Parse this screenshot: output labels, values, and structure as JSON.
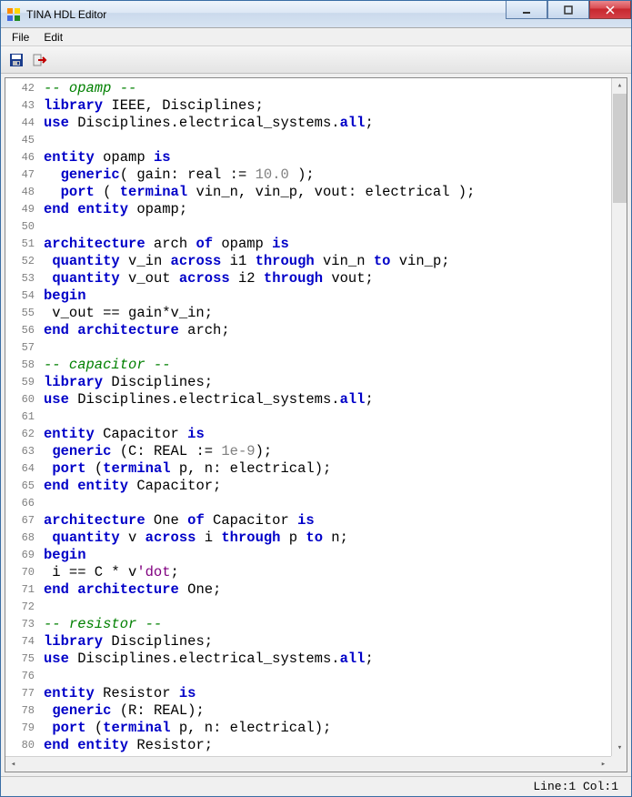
{
  "window": {
    "title": "TINA HDL Editor"
  },
  "menubar": {
    "file": "File",
    "edit": "Edit"
  },
  "statusbar": {
    "pos": "Line:1 Col:1"
  },
  "code": [
    {
      "n": 42,
      "tokens": [
        {
          "c": "comment",
          "t": "-- opamp --"
        }
      ]
    },
    {
      "n": 43,
      "tokens": [
        {
          "c": "kw",
          "t": "library"
        },
        {
          "c": "punct",
          "t": " "
        },
        {
          "c": "ident",
          "t": "IEEE, Disciplines;"
        }
      ]
    },
    {
      "n": 44,
      "tokens": [
        {
          "c": "kw",
          "t": "use"
        },
        {
          "c": "punct",
          "t": " "
        },
        {
          "c": "ident",
          "t": "Disciplines.electrical_systems."
        },
        {
          "c": "kw",
          "t": "all"
        },
        {
          "c": "punct",
          "t": ";"
        }
      ]
    },
    {
      "n": 45,
      "tokens": []
    },
    {
      "n": 46,
      "tokens": [
        {
          "c": "kw",
          "t": "entity"
        },
        {
          "c": "punct",
          "t": " "
        },
        {
          "c": "ident",
          "t": "opamp "
        },
        {
          "c": "kw",
          "t": "is"
        }
      ]
    },
    {
      "n": 47,
      "tokens": [
        {
          "c": "punct",
          "t": "  "
        },
        {
          "c": "kw",
          "t": "generic"
        },
        {
          "c": "punct",
          "t": "( gain: "
        },
        {
          "c": "ident",
          "t": "real"
        },
        {
          "c": "punct",
          "t": " := "
        },
        {
          "c": "num",
          "t": "10.0"
        },
        {
          "c": "punct",
          "t": " );"
        }
      ]
    },
    {
      "n": 48,
      "tokens": [
        {
          "c": "punct",
          "t": "  "
        },
        {
          "c": "kw",
          "t": "port"
        },
        {
          "c": "punct",
          "t": " ( "
        },
        {
          "c": "kw",
          "t": "terminal"
        },
        {
          "c": "punct",
          "t": " vin_n, vin_p, vout: electrical );"
        }
      ]
    },
    {
      "n": 49,
      "tokens": [
        {
          "c": "kw",
          "t": "end"
        },
        {
          "c": "punct",
          "t": " "
        },
        {
          "c": "kw",
          "t": "entity"
        },
        {
          "c": "punct",
          "t": " opamp;"
        }
      ]
    },
    {
      "n": 50,
      "tokens": []
    },
    {
      "n": 51,
      "tokens": [
        {
          "c": "kw",
          "t": "architecture"
        },
        {
          "c": "punct",
          "t": " arch "
        },
        {
          "c": "kw",
          "t": "of"
        },
        {
          "c": "punct",
          "t": " opamp "
        },
        {
          "c": "kw",
          "t": "is"
        }
      ]
    },
    {
      "n": 52,
      "tokens": [
        {
          "c": "punct",
          "t": " "
        },
        {
          "c": "kw",
          "t": "quantity"
        },
        {
          "c": "punct",
          "t": " v_in "
        },
        {
          "c": "kw",
          "t": "across"
        },
        {
          "c": "punct",
          "t": " i1 "
        },
        {
          "c": "kw",
          "t": "through"
        },
        {
          "c": "punct",
          "t": " vin_n "
        },
        {
          "c": "kw",
          "t": "to"
        },
        {
          "c": "punct",
          "t": " vin_p;"
        }
      ]
    },
    {
      "n": 53,
      "tokens": [
        {
          "c": "punct",
          "t": " "
        },
        {
          "c": "kw",
          "t": "quantity"
        },
        {
          "c": "punct",
          "t": " v_out "
        },
        {
          "c": "kw",
          "t": "across"
        },
        {
          "c": "punct",
          "t": " i2 "
        },
        {
          "c": "kw",
          "t": "through"
        },
        {
          "c": "punct",
          "t": " vout;"
        }
      ]
    },
    {
      "n": 54,
      "tokens": [
        {
          "c": "kw",
          "t": "begin"
        }
      ]
    },
    {
      "n": 55,
      "tokens": [
        {
          "c": "punct",
          "t": " v_out == gain*v_in;"
        }
      ]
    },
    {
      "n": 56,
      "tokens": [
        {
          "c": "kw",
          "t": "end"
        },
        {
          "c": "punct",
          "t": " "
        },
        {
          "c": "kw",
          "t": "architecture"
        },
        {
          "c": "punct",
          "t": " arch;"
        }
      ]
    },
    {
      "n": 57,
      "tokens": []
    },
    {
      "n": 58,
      "tokens": [
        {
          "c": "comment",
          "t": "-- capacitor --"
        }
      ]
    },
    {
      "n": 59,
      "tokens": [
        {
          "c": "kw",
          "t": "library"
        },
        {
          "c": "punct",
          "t": " Disciplines;"
        }
      ]
    },
    {
      "n": 60,
      "tokens": [
        {
          "c": "kw",
          "t": "use"
        },
        {
          "c": "punct",
          "t": " Disciplines.electrical_systems."
        },
        {
          "c": "kw",
          "t": "all"
        },
        {
          "c": "punct",
          "t": ";"
        }
      ]
    },
    {
      "n": 61,
      "tokens": []
    },
    {
      "n": 62,
      "tokens": [
        {
          "c": "kw",
          "t": "entity"
        },
        {
          "c": "punct",
          "t": " Capacitor "
        },
        {
          "c": "kw",
          "t": "is"
        }
      ]
    },
    {
      "n": 63,
      "tokens": [
        {
          "c": "punct",
          "t": " "
        },
        {
          "c": "kw",
          "t": "generic"
        },
        {
          "c": "punct",
          "t": " (C: REAL := "
        },
        {
          "c": "num",
          "t": "1e-9"
        },
        {
          "c": "punct",
          "t": ");"
        }
      ]
    },
    {
      "n": 64,
      "tokens": [
        {
          "c": "punct",
          "t": " "
        },
        {
          "c": "kw",
          "t": "port"
        },
        {
          "c": "punct",
          "t": " ("
        },
        {
          "c": "kw",
          "t": "terminal"
        },
        {
          "c": "punct",
          "t": " p, n: electrical);"
        }
      ]
    },
    {
      "n": 65,
      "tokens": [
        {
          "c": "kw",
          "t": "end"
        },
        {
          "c": "punct",
          "t": " "
        },
        {
          "c": "kw",
          "t": "entity"
        },
        {
          "c": "punct",
          "t": " Capacitor;"
        }
      ]
    },
    {
      "n": 66,
      "tokens": []
    },
    {
      "n": 67,
      "tokens": [
        {
          "c": "kw",
          "t": "architecture"
        },
        {
          "c": "punct",
          "t": " One "
        },
        {
          "c": "kw",
          "t": "of"
        },
        {
          "c": "punct",
          "t": " Capacitor "
        },
        {
          "c": "kw",
          "t": "is"
        }
      ]
    },
    {
      "n": 68,
      "tokens": [
        {
          "c": "punct",
          "t": " "
        },
        {
          "c": "kw",
          "t": "quantity"
        },
        {
          "c": "punct",
          "t": " v "
        },
        {
          "c": "kw",
          "t": "across"
        },
        {
          "c": "punct",
          "t": " i "
        },
        {
          "c": "kw",
          "t": "through"
        },
        {
          "c": "punct",
          "t": " p "
        },
        {
          "c": "kw",
          "t": "to"
        },
        {
          "c": "punct",
          "t": " n;"
        }
      ]
    },
    {
      "n": 69,
      "tokens": [
        {
          "c": "kw",
          "t": "begin"
        }
      ]
    },
    {
      "n": 70,
      "tokens": [
        {
          "c": "punct",
          "t": " i == C * v"
        },
        {
          "c": "attr",
          "t": "'dot"
        },
        {
          "c": "punct",
          "t": ";"
        }
      ]
    },
    {
      "n": 71,
      "tokens": [
        {
          "c": "kw",
          "t": "end"
        },
        {
          "c": "punct",
          "t": " "
        },
        {
          "c": "kw",
          "t": "architecture"
        },
        {
          "c": "punct",
          "t": " One;"
        }
      ]
    },
    {
      "n": 72,
      "tokens": []
    },
    {
      "n": 73,
      "tokens": [
        {
          "c": "comment",
          "t": "-- resistor --"
        }
      ]
    },
    {
      "n": 74,
      "tokens": [
        {
          "c": "kw",
          "t": "library"
        },
        {
          "c": "punct",
          "t": " Disciplines;"
        }
      ]
    },
    {
      "n": 75,
      "tokens": [
        {
          "c": "kw",
          "t": "use"
        },
        {
          "c": "punct",
          "t": " Disciplines.electrical_systems."
        },
        {
          "c": "kw",
          "t": "all"
        },
        {
          "c": "punct",
          "t": ";"
        }
      ]
    },
    {
      "n": 76,
      "tokens": []
    },
    {
      "n": 77,
      "tokens": [
        {
          "c": "kw",
          "t": "entity"
        },
        {
          "c": "punct",
          "t": " Resistor "
        },
        {
          "c": "kw",
          "t": "is"
        }
      ]
    },
    {
      "n": 78,
      "tokens": [
        {
          "c": "punct",
          "t": " "
        },
        {
          "c": "kw",
          "t": "generic"
        },
        {
          "c": "punct",
          "t": " (R: REAL);"
        }
      ]
    },
    {
      "n": 79,
      "tokens": [
        {
          "c": "punct",
          "t": " "
        },
        {
          "c": "kw",
          "t": "port"
        },
        {
          "c": "punct",
          "t": " ("
        },
        {
          "c": "kw",
          "t": "terminal"
        },
        {
          "c": "punct",
          "t": " p, n: electrical);"
        }
      ]
    },
    {
      "n": 80,
      "tokens": [
        {
          "c": "kw",
          "t": "end"
        },
        {
          "c": "punct",
          "t": " "
        },
        {
          "c": "kw",
          "t": "entity"
        },
        {
          "c": "punct",
          "t": " Resistor;"
        }
      ]
    }
  ]
}
